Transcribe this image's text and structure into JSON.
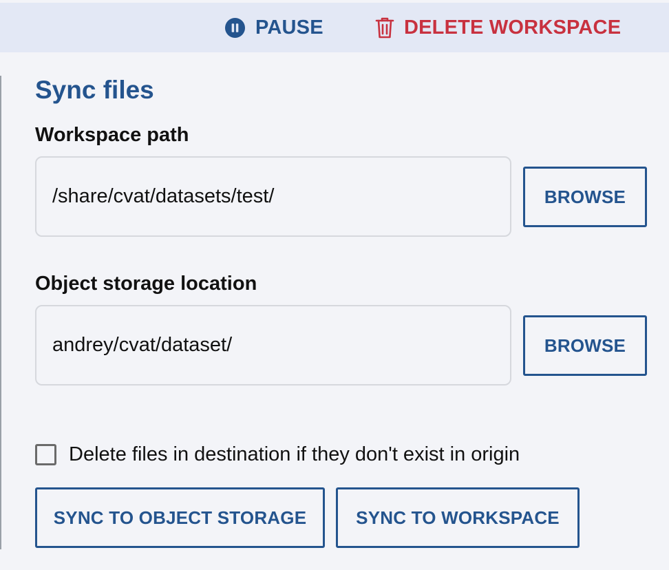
{
  "toolbar": {
    "pause_label": "PAUSE",
    "delete_label": "DELETE WORKSPACE",
    "pause_icon": "pause-circle-icon",
    "delete_icon": "trash-icon"
  },
  "sync": {
    "title": "Sync files",
    "workspace_path": {
      "label": "Workspace path",
      "value": "/share/cvat/datasets/test/",
      "browse_label": "BROWSE"
    },
    "object_storage": {
      "label": "Object storage location",
      "value": "andrey/cvat/dataset/",
      "browse_label": "BROWSE"
    },
    "delete_option": {
      "label": "Delete files in destination if they don't exist in origin",
      "checked": false
    },
    "sync_to_object_storage_label": "SYNC TO OBJECT STORAGE",
    "sync_to_workspace_label": "SYNC TO WORKSPACE"
  },
  "colors": {
    "primary": "#24548e",
    "danger": "#c8313f",
    "topbar_bg": "#e3e8f5",
    "panel_bg": "#f3f4f8"
  }
}
